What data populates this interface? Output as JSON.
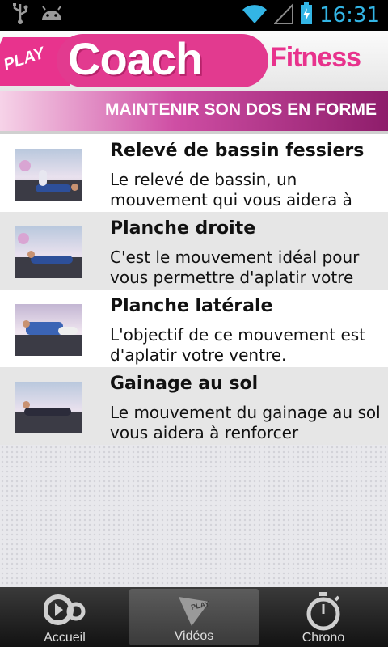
{
  "status_bar": {
    "time": "16:31",
    "icons": [
      "usb-icon",
      "android-icon",
      "wifi-icon",
      "signal-icon",
      "battery-charging-icon"
    ]
  },
  "header": {
    "logo_play": "PLAY",
    "logo_coach": "Coach",
    "logo_fitness": "Fitness",
    "brand_color": "#e8338d"
  },
  "section": {
    "title": "MAINTENIR SON DOS EN FORME"
  },
  "exercises": [
    {
      "title": "Relevé de bassin fessiers",
      "description": "Le relevé de bassin, un mouvement qui vous aidera à"
    },
    {
      "title": "Planche droite",
      "description": "C'est le mouvement idéal pour vous permettre d'aplatir votre"
    },
    {
      "title": "Planche latérale",
      "description": "L'objectif de ce mouvement est d'aplatir votre ventre."
    },
    {
      "title": "Gainage au sol",
      "description": "Le mouvement du gainage au sol vous aidera à renforcer"
    }
  ],
  "bottom_nav": {
    "tabs": [
      {
        "label": "Accueil",
        "icon": "home-logo-icon"
      },
      {
        "label": "Vidéos",
        "icon": "play-video-icon",
        "active": true
      },
      {
        "label": "Chrono",
        "icon": "stopwatch-icon"
      }
    ]
  }
}
